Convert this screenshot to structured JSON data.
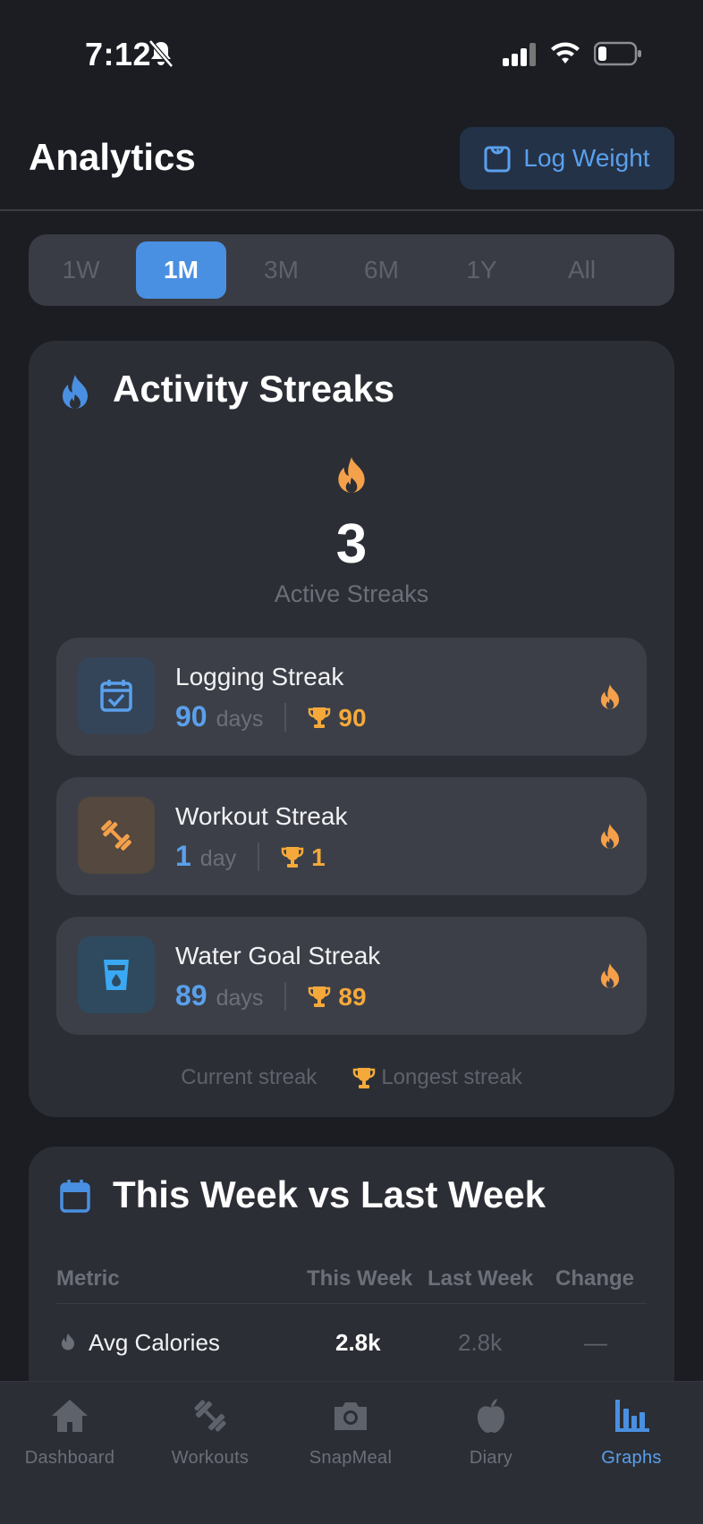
{
  "status_bar": {
    "time": "7:12"
  },
  "header": {
    "title": "Analytics",
    "log_weight_label": "Log Weight"
  },
  "range_tabs": [
    {
      "label": "1W",
      "active": false
    },
    {
      "label": "1M",
      "active": true
    },
    {
      "label": "3M",
      "active": false
    },
    {
      "label": "6M",
      "active": false
    },
    {
      "label": "1Y",
      "active": false
    },
    {
      "label": "All",
      "active": false
    }
  ],
  "streaks": {
    "title": "Activity Streaks",
    "active_count": "3",
    "active_label": "Active Streaks",
    "items": [
      {
        "name": "Logging Streak",
        "value": "90",
        "unit": "days",
        "best": "90",
        "icon": "calendar-check-icon"
      },
      {
        "name": "Workout Streak",
        "value": "1",
        "unit": "day",
        "best": "1",
        "icon": "dumbbell-icon"
      },
      {
        "name": "Water Goal Streak",
        "value": "89",
        "unit": "days",
        "best": "89",
        "icon": "water-glass-icon"
      }
    ],
    "legend": {
      "current": "Current streak",
      "longest": "Longest streak"
    }
  },
  "week_compare": {
    "title": "This Week vs Last Week",
    "columns": [
      "Metric",
      "This Week",
      "Last Week",
      "Change"
    ],
    "rows": [
      {
        "metric": "Avg Calories",
        "this_week": "2.8k",
        "last_week": "2.8k",
        "change": "—"
      }
    ]
  },
  "tab_bar": [
    {
      "label": "Dashboard",
      "icon": "home-icon",
      "active": false
    },
    {
      "label": "Workouts",
      "icon": "dumbbell-icon",
      "active": false
    },
    {
      "label": "SnapMeal",
      "icon": "camera-icon",
      "active": false
    },
    {
      "label": "Diary",
      "icon": "apple-icon",
      "active": false
    },
    {
      "label": "Graphs",
      "icon": "bar-chart-icon",
      "active": true
    }
  ],
  "colors": {
    "accent": "#4a90e2",
    "flame": "#f5a04a",
    "trophy": "#f5a93b",
    "background": "#1b1d23",
    "card": "#2b2e35"
  }
}
